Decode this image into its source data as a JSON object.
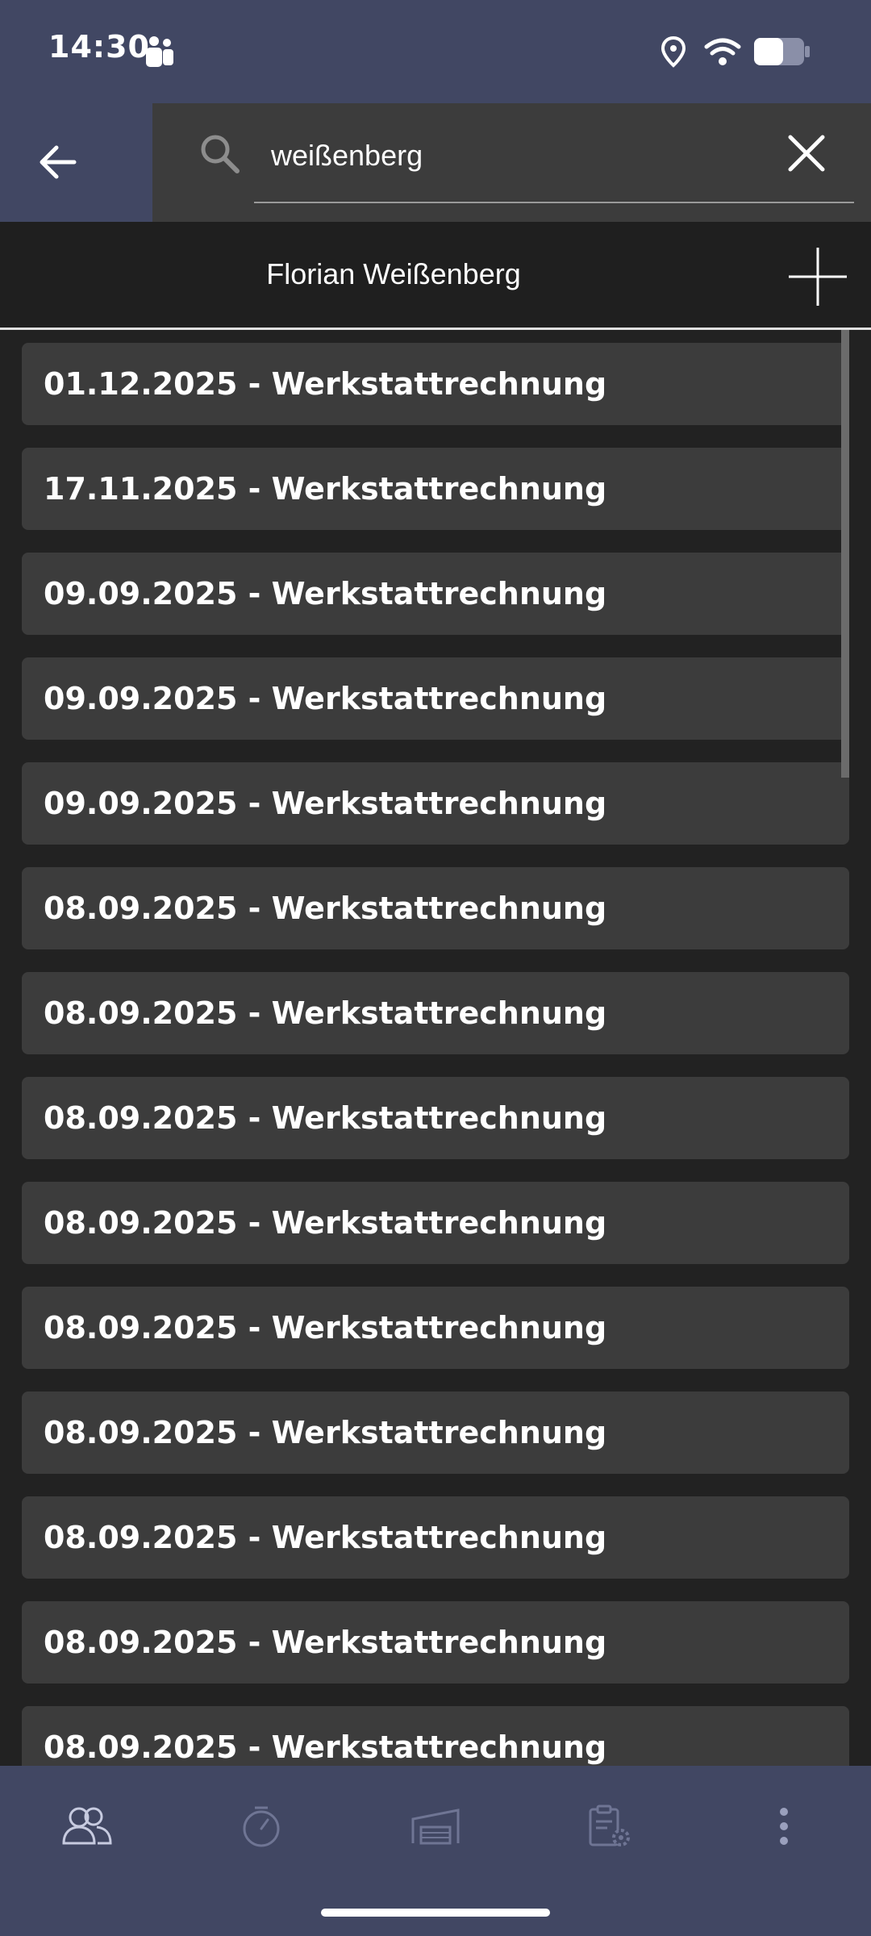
{
  "status_bar": {
    "time": "14:30",
    "icons": [
      "teams-icon",
      "location-icon",
      "wifi-icon",
      "battery-icon"
    ]
  },
  "search": {
    "value": "weißenberg",
    "icons": [
      "back-arrow-icon",
      "search-icon",
      "close-icon"
    ]
  },
  "header": {
    "title": "Florian Weißenberg",
    "add_icon": "plus-icon"
  },
  "list": {
    "items": [
      "01.12.2025 - Werkstattrechnung",
      "17.11.2025 - Werkstattrechnung",
      "09.09.2025 - Werkstattrechnung",
      "09.09.2025 - Werkstattrechnung",
      "09.09.2025 - Werkstattrechnung",
      "08.09.2025 - Werkstattrechnung",
      "08.09.2025 - Werkstattrechnung",
      "08.09.2025 - Werkstattrechnung",
      "08.09.2025 - Werkstattrechnung",
      "08.09.2025 - Werkstattrechnung",
      "08.09.2025 - Werkstattrechnung",
      "08.09.2025 - Werkstattrechnung",
      "08.09.2025 - Werkstattrechnung",
      "08.09.2025 - Werkstattrechnung"
    ]
  },
  "bottom_nav": {
    "items": [
      "customers-icon",
      "timer-icon",
      "garage-icon",
      "clipboard-settings-icon",
      "more-vertical-icon"
    ]
  },
  "colors": {
    "bar": "#414763",
    "background": "#222222",
    "item": "#3c3c3c",
    "text": "#ffffff"
  }
}
